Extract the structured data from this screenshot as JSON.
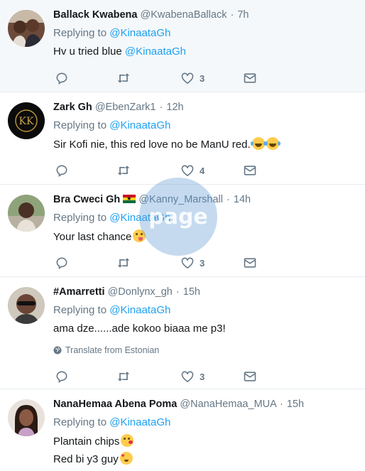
{
  "tweets": [
    {
      "name": "Ballack Kwabena",
      "handle": "@KwabenaBallack",
      "time": "7h",
      "replying_prefix": "Replying to",
      "replying_to": "@KinaataGh",
      "text_prefix": "Hv u tried blue",
      "text_mention": "@KinaataGh",
      "likes": "3"
    },
    {
      "name": "Zark Gh",
      "handle": "@EbenZark1",
      "time": "12h",
      "replying_prefix": "Replying to",
      "replying_to": "@KinaataGh",
      "text": "Sir Kofi nie, this red love no be ManU red.",
      "emojis": [
        "laugh",
        "laugh"
      ],
      "likes": "4",
      "avatar_logo": "KK"
    },
    {
      "name": "Bra Cweci Gh",
      "flag": "ghana-flag",
      "handle": "@Kanny_Marshall",
      "time": "14h",
      "replying_prefix": "Replying to",
      "replying_to": "@KinaataGh",
      "text": "Your last chance",
      "emojis": [
        "wink"
      ],
      "likes": "3"
    },
    {
      "name": "#Amarretti",
      "handle": "@Donlynx_gh",
      "time": "15h",
      "replying_prefix": "Replying to",
      "replying_to": "@KinaataGh",
      "text": "ama dze......ade kokoo biaaa me p3!",
      "translate": "Translate from Estonian",
      "likes": "3"
    },
    {
      "name": "NanaHemaa Abena Poma",
      "handle": "@NanaHemaa_MUA",
      "time": "15h",
      "replying_prefix": "Replying to",
      "replying_to": "@KinaataGh",
      "line1": "Plantain chips",
      "line2": "Red bi y3 guy"
    }
  ],
  "separator": "·",
  "watermark": "page",
  "colors": {
    "link": "#1da1f2",
    "muted": "#657786",
    "text": "#14171a",
    "highlight_bg": "#f5f8fa"
  }
}
